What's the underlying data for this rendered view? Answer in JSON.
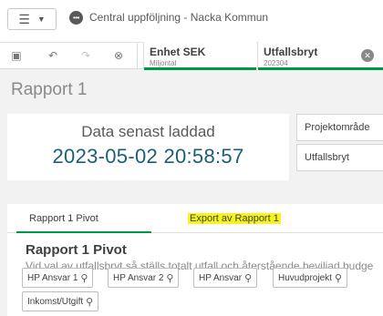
{
  "header": {
    "app_icon": "dots-icon",
    "app_title": "Central uppföljning - Nacka Kommun"
  },
  "selections": [
    {
      "name": "Enhet SEK",
      "value": "Miljontal"
    },
    {
      "name": "Utfallsbryt",
      "value": "202304"
    }
  ],
  "sheet": {
    "title": "Rapport 1"
  },
  "kpi": {
    "label": "Data senast laddad",
    "value": "2023-05-02 20:58:57"
  },
  "filters_right": [
    "Projektområde",
    "Utfallsbryt"
  ],
  "tabs": [
    {
      "label": "Rapport 1 Pivot",
      "active": true
    },
    {
      "label": "Export av Rapport 1",
      "highlighted": true
    }
  ],
  "panel": {
    "title": "Rapport 1 Pivot",
    "subtitle": "Vid val av utfallsbryt så ställs totalt utfall och återstående beviljad budge"
  },
  "field_buttons": [
    "HP Ansvar 1",
    "HP Ansvar 2",
    "HP Ansvar",
    "Huvudprojekt",
    "Inkomst/Utgift"
  ],
  "colors": {
    "accent": "#009845",
    "kpi_value": "#1b5e7a",
    "highlight": "#f7f31f"
  }
}
